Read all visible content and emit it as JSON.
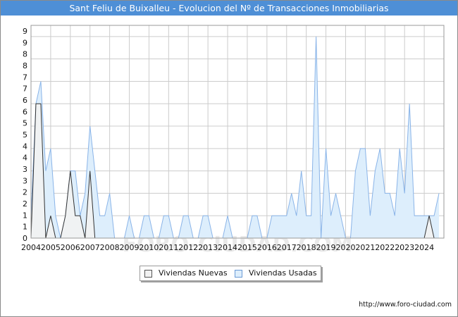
{
  "title": "Sant Feliu de Buixalleu - Evolucion del Nº de Transacciones Inmobiliarias",
  "footer_url": "http://www.foro-ciudad.com",
  "watermark": "FORO-CIUDAD.COM",
  "colors": {
    "title_bg": "#4e8fd6",
    "nuevas_fill": "#f2f2f2",
    "nuevas_line": "#333333",
    "usadas_fill": "#ddeefc",
    "usadas_line": "#8ab4e8",
    "grid": "#cccccc"
  },
  "chart_data": {
    "type": "area",
    "title": "Sant Feliu de Buixalleu - Evolucion del Nº de Transacciones Inmobiliarias",
    "xlabel": "",
    "ylabel": "",
    "x_range": [
      2004,
      2025
    ],
    "ylim": [
      0,
      9.5
    ],
    "yticks": [
      0,
      1,
      1,
      2,
      2,
      3,
      3,
      4,
      4,
      5,
      5,
      6,
      6,
      7,
      7,
      8,
      8,
      9,
      9
    ],
    "xticks": [
      "2004",
      "2005",
      "2006",
      "2007",
      "2008",
      "2009",
      "2010",
      "2011",
      "2012",
      "2013",
      "2014",
      "2015",
      "2016",
      "2017",
      "2018",
      "2019",
      "2020",
      "2021",
      "2022",
      "2023",
      "2024"
    ],
    "grid": true,
    "legend_position": "bottom-center",
    "x_step": "quarter",
    "series": [
      {
        "name": "Viviendas Nuevas",
        "values": [
          0,
          6,
          6,
          0,
          1,
          0,
          0,
          1,
          3,
          1,
          1,
          0,
          3,
          0,
          0,
          0,
          0,
          0,
          0,
          0,
          0,
          0,
          0,
          0,
          0,
          0,
          0,
          0,
          0,
          0,
          0,
          0,
          0,
          0,
          0,
          0,
          0,
          0,
          0,
          0,
          0,
          0,
          0,
          0,
          0,
          0,
          0,
          0,
          0,
          0,
          0,
          0,
          0,
          0,
          0,
          0,
          0,
          0,
          0,
          0,
          0,
          0,
          0,
          0,
          0,
          0,
          0,
          0,
          0,
          0,
          0,
          0,
          0,
          0,
          0,
          0,
          0,
          0,
          0,
          0,
          0,
          1,
          0,
          0
        ]
      },
      {
        "name": "Viviendas Usadas",
        "values": [
          1,
          6,
          7,
          3,
          4,
          1,
          0,
          1,
          3,
          3,
          1,
          2,
          5,
          3,
          1,
          1,
          2,
          0,
          0,
          0,
          1,
          0,
          0,
          1,
          1,
          0,
          0,
          1,
          1,
          0,
          0,
          1,
          1,
          0,
          0,
          1,
          1,
          0,
          0,
          0,
          1,
          0,
          0,
          0,
          0,
          1,
          1,
          0,
          0,
          1,
          1,
          1,
          1,
          2,
          1,
          3,
          1,
          1,
          9,
          0,
          4,
          1,
          2,
          1,
          0,
          0,
          3,
          4,
          4,
          1,
          3,
          4,
          2,
          2,
          1,
          4,
          2,
          6,
          1,
          1,
          1,
          1,
          1,
          2
        ]
      }
    ]
  }
}
